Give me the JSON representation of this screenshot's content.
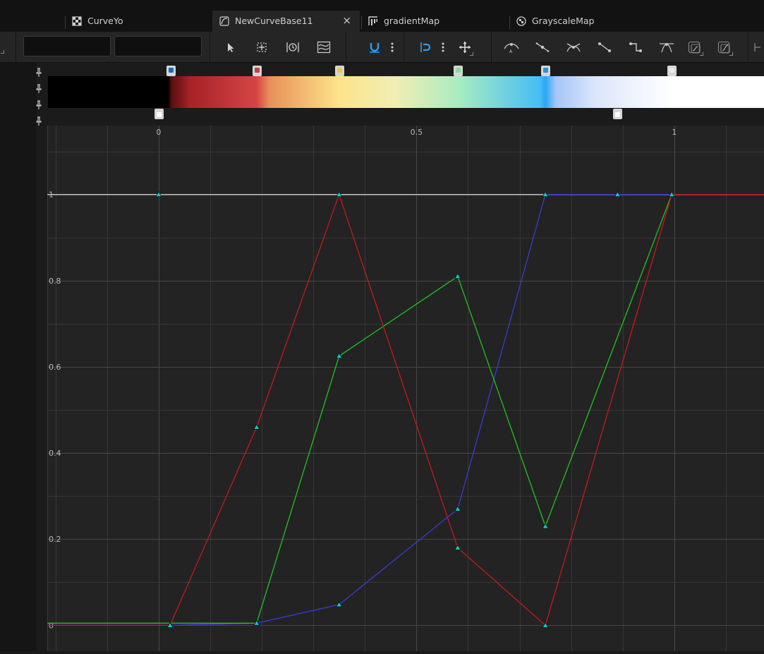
{
  "tabs": [
    {
      "label": "CurveYo",
      "icon": "checker-icon",
      "active": false
    },
    {
      "label": "NewCurveBase11",
      "icon": "curve-asset-icon",
      "active": true,
      "close": "×"
    },
    {
      "label": "gradientMap",
      "icon": "gradient-map-icon",
      "active": false
    },
    {
      "label": "GrayscaleMap",
      "icon": "checker-circle-icon",
      "active": false
    }
  ],
  "toolbar": {
    "time_field_value": "",
    "value_field_value": "",
    "tools": [
      "select-arrow-icon",
      "transform-icon",
      "retime-icon",
      "multi-scale-icon",
      "snap-magnet-icon",
      "more-vertical-icon",
      "snap-time-icon",
      "more-vertical-icon",
      "move-cross-icon",
      "auto-tangent-icon",
      "user-tangent-icon",
      "break-tangent-icon",
      "linear-tangent-icon",
      "constant-tangent-icon",
      "weighted-tangent-icon",
      "pre-infinity-icon",
      "post-infinity-icon"
    ]
  },
  "gradient": {
    "color_stops": [
      {
        "t": 0.023,
        "color": "#0b6fc7"
      },
      {
        "t": 0.19,
        "color": "#d23c3c"
      },
      {
        "t": 0.35,
        "color": "#f3c34a"
      },
      {
        "t": 0.58,
        "color": "#7fe09a"
      },
      {
        "t": 0.75,
        "color": "#2a8fe6"
      },
      {
        "t": 0.995,
        "color": "#e8e8e8"
      }
    ],
    "alpha_stops": [
      {
        "t": 0.0,
        "color": "#ffffff"
      },
      {
        "t": 0.89,
        "color": "#ffffff"
      }
    ],
    "ramp": [
      {
        "t": -0.25,
        "color": "#000000"
      },
      {
        "t": 0.018,
        "color": "#000000"
      },
      {
        "t": 0.025,
        "color": "#5a0f12"
      },
      {
        "t": 0.06,
        "color": "#a52226"
      },
      {
        "t": 0.19,
        "color": "#d64545"
      },
      {
        "t": 0.215,
        "color": "#e89058"
      },
      {
        "t": 0.35,
        "color": "#fde48a"
      },
      {
        "t": 0.46,
        "color": "#f0eeb4"
      },
      {
        "t": 0.58,
        "color": "#a9ecc0"
      },
      {
        "t": 0.74,
        "color": "#46bdf5"
      },
      {
        "t": 0.75,
        "color": "#2aa6f4"
      },
      {
        "t": 0.77,
        "color": "#a5c6f7"
      },
      {
        "t": 0.85,
        "color": "#dde7fb"
      },
      {
        "t": 1.0,
        "color": "#ffffff"
      },
      {
        "t": 1.17,
        "color": "#ffffff"
      }
    ]
  },
  "graph": {
    "x_ticks": [
      {
        "v": 0,
        "label": "0"
      },
      {
        "v": 0.5,
        "label": "0.5"
      },
      {
        "v": 1,
        "label": "1"
      }
    ],
    "y_ticks": [
      {
        "v": 0,
        "label": "0"
      },
      {
        "v": 0.2,
        "label": "0.2"
      },
      {
        "v": 0.4,
        "label": "0.4"
      },
      {
        "v": 0.6,
        "label": "0.6"
      },
      {
        "v": 0.8,
        "label": "0.8"
      },
      {
        "v": 1,
        "label": "1"
      }
    ],
    "x_range": [
      -0.216,
      1.174
    ],
    "y_range": [
      -0.06,
      1.16
    ],
    "curves": [
      {
        "name": "red",
        "color": "#c8181c",
        "keys": [
          [
            0.022,
            0
          ],
          [
            0.19,
            0.46
          ],
          [
            0.35,
            1
          ],
          [
            0.58,
            0.18
          ],
          [
            0.75,
            0
          ],
          [
            0.995,
            1
          ]
        ]
      },
      {
        "name": "green",
        "color": "#1fc41f",
        "keys": [
          [
            0.19,
            0.005
          ],
          [
            0.35,
            0.625
          ],
          [
            0.58,
            0.81
          ],
          [
            0.75,
            0.23
          ],
          [
            0.995,
            1
          ]
        ]
      },
      {
        "name": "blue",
        "color": "#3a3ad8",
        "keys": [
          [
            0.022,
            0
          ],
          [
            0.19,
            0.005
          ],
          [
            0.35,
            0.048
          ],
          [
            0.58,
            0.27
          ],
          [
            0.75,
            1
          ],
          [
            0.89,
            1
          ]
        ]
      },
      {
        "name": "alpha",
        "color": "#c4c4c4",
        "keys": [
          [
            0.0,
            1
          ],
          [
            0.89,
            1
          ]
        ]
      }
    ],
    "colors": {
      "key_fill": "#19c7c0",
      "key_stroke": "#062020",
      "grid": "#363636",
      "grid_major": "#474747"
    }
  }
}
